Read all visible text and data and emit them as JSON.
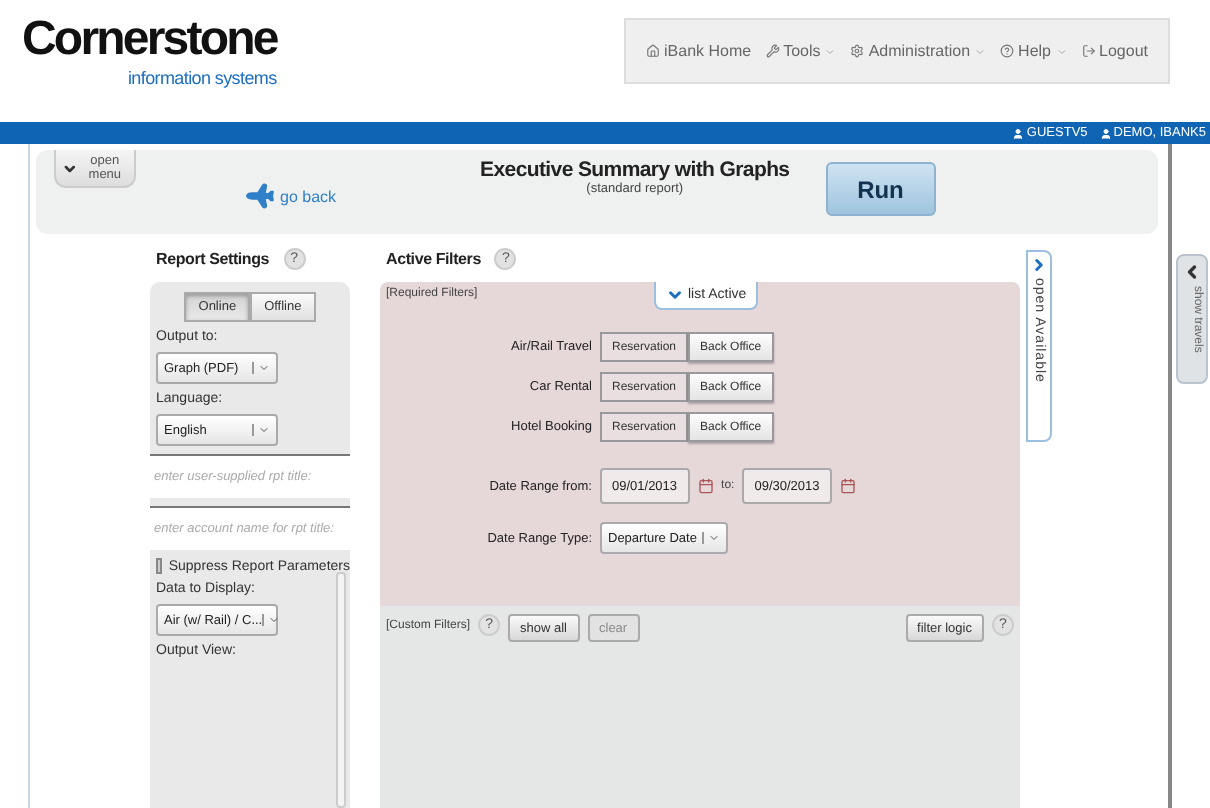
{
  "logo": {
    "name": "Cornerstone",
    "tagline": "information systems"
  },
  "nav": [
    {
      "label": "iBank Home",
      "dropdown": false
    },
    {
      "label": "Tools",
      "dropdown": true
    },
    {
      "label": "Administration",
      "dropdown": true
    },
    {
      "label": "Help",
      "dropdown": true
    },
    {
      "label": "Logout",
      "dropdown": false
    }
  ],
  "user_bar": [
    {
      "label": "GUESTV5"
    },
    {
      "label": "DEMO, IBANK5"
    }
  ],
  "toolbar": {
    "menu_button": "open menu",
    "back_link": "go back",
    "title": "Executive Summary with Graphs",
    "subtitle": "(standard report)",
    "run_button": "Run"
  },
  "report_settings": {
    "title": "Report Settings",
    "help": "?",
    "mode": [
      {
        "label": "Online",
        "selected": true
      },
      {
        "label": "Offline",
        "selected": false
      }
    ],
    "fields": [
      {
        "kind": "label",
        "text": "Output to:"
      },
      {
        "kind": "select",
        "value": "Graph (PDF)"
      },
      {
        "kind": "label",
        "text": "Language:"
      },
      {
        "kind": "select",
        "value": "English"
      },
      {
        "kind": "input",
        "placeholder": "enter user-supplied rpt title:"
      },
      {
        "kind": "input",
        "placeholder": "enter account name for rpt title:"
      },
      {
        "kind": "checkbox",
        "label": "Suppress Report Parameters",
        "checked": false
      },
      {
        "kind": "label",
        "text": "Data to Display:"
      },
      {
        "kind": "select",
        "value": "Air (w/ Rail) / C..."
      },
      {
        "kind": "label",
        "text": "Output View:"
      }
    ]
  },
  "active_filters": {
    "title": "Active Filters",
    "help": "?",
    "required": {
      "label": "[Required Filters]",
      "list_button": "list Active",
      "rows": [
        {
          "label": "Air/Rail Travel",
          "options": [
            {
              "label": "Reservation",
              "selected": false
            },
            {
              "label": "Back Office",
              "selected": true
            }
          ]
        },
        {
          "label": "Car Rental",
          "options": [
            {
              "label": "Reservation",
              "selected": false
            },
            {
              "label": "Back Office",
              "selected": true
            }
          ]
        },
        {
          "label": "Hotel Booking",
          "options": [
            {
              "label": "Reservation",
              "selected": false
            },
            {
              "label": "Back Office",
              "selected": true
            }
          ]
        }
      ],
      "date_from": {
        "label": "Date Range from:",
        "value": "09/01/2013"
      },
      "date_to": {
        "label": "to:",
        "value": "09/30/2013"
      },
      "date_type": {
        "label": "Date Range Type:",
        "value": "Departure Date"
      }
    },
    "custom": {
      "label": "[Custom Filters]",
      "help": "?",
      "buttons": [
        {
          "label": "show all",
          "disabled": false
        },
        {
          "label": "clear",
          "disabled": true
        }
      ],
      "logic_button": "filter logic",
      "logic_help": "?"
    }
  },
  "side_tabs": {
    "available": "open Available",
    "travels": "show travels"
  }
}
